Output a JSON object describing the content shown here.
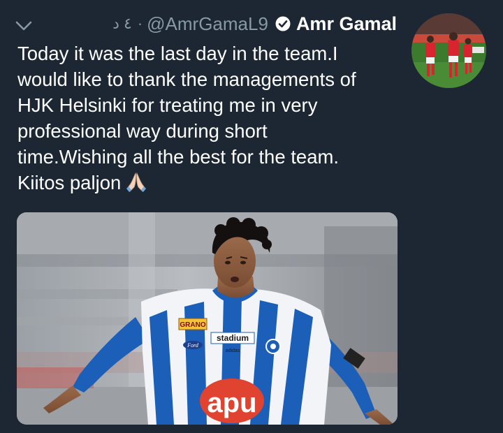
{
  "tweet": {
    "display_name": "Amr Gamal",
    "handle": "@AmrGamaL9",
    "timestamp": "٤ د",
    "separator": "·",
    "text_lines": [
      "Today it was the last day in the team.I",
      "would like to thank the managements of",
      "HJK Helsinki for treating me in very",
      "professional way during short",
      "time.Wishing all the best for the team.",
      "Kiitos paljon"
    ],
    "emoji": "folded-hands",
    "verified": true,
    "menu_icon": "chevron-down-icon",
    "media": {
      "jersey_sponsor": "apu",
      "jersey_brand": "stadium",
      "sleeve_sponsor": "GRANO",
      "kit_maker": "adidas",
      "car_sponsor": "Ford"
    }
  },
  "colors": {
    "background": "#1c2733",
    "text_primary": "#ffffff",
    "text_secondary": "#8899a6",
    "jersey_blue": "#1c5fb8"
  }
}
